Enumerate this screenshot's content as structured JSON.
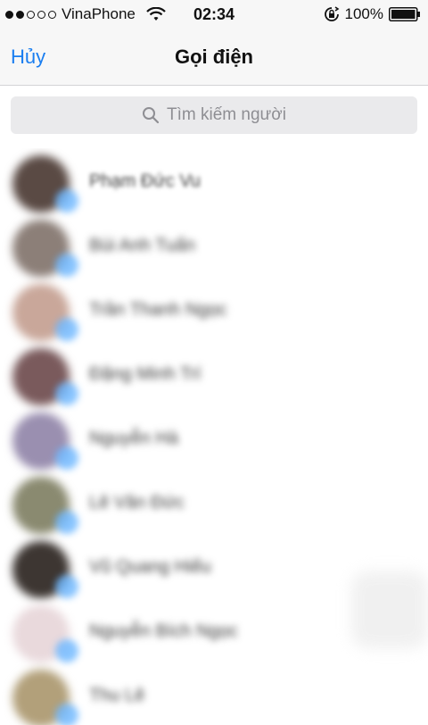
{
  "status_bar": {
    "carrier": "VinaPhone",
    "time": "02:34",
    "battery": "100%",
    "signal_icon": "signal-dots-icon",
    "wifi_icon": "wifi-icon",
    "rotation_lock_icon": "rotation-lock-icon",
    "battery_icon": "battery-icon"
  },
  "nav": {
    "cancel_label": "Hủy",
    "title": "Gọi điện"
  },
  "search": {
    "placeholder": "Tìm kiếm người",
    "icon": "search-icon"
  },
  "contacts": [
    {
      "name": "Phạm Đức Vu",
      "avatar_color": "#5a4a44"
    },
    {
      "name": "Bùi Anh Tuấn",
      "avatar_color": "#8c7f78"
    },
    {
      "name": "Trần Thanh Ngọc",
      "avatar_color": "#c9a79a"
    },
    {
      "name": "Đặng Minh Trí",
      "avatar_color": "#7a5a5c"
    },
    {
      "name": "Nguyễn Hà",
      "avatar_color": "#9a8fb0"
    },
    {
      "name": "Lê Văn Đức",
      "avatar_color": "#8a8a70"
    },
    {
      "name": "Vũ Quang Hiếu",
      "avatar_color": "#3d3632"
    },
    {
      "name": "Nguyễn Bích Ngọc",
      "avatar_color": "#e9d9dc"
    },
    {
      "name": "Thu Lê",
      "avatar_color": "#b2a07a"
    }
  ],
  "colors": {
    "accent": "#1a7ef0",
    "badge": "#6bb6ff",
    "nav_background": "#f7f7f7",
    "search_background": "#eaeaec"
  }
}
